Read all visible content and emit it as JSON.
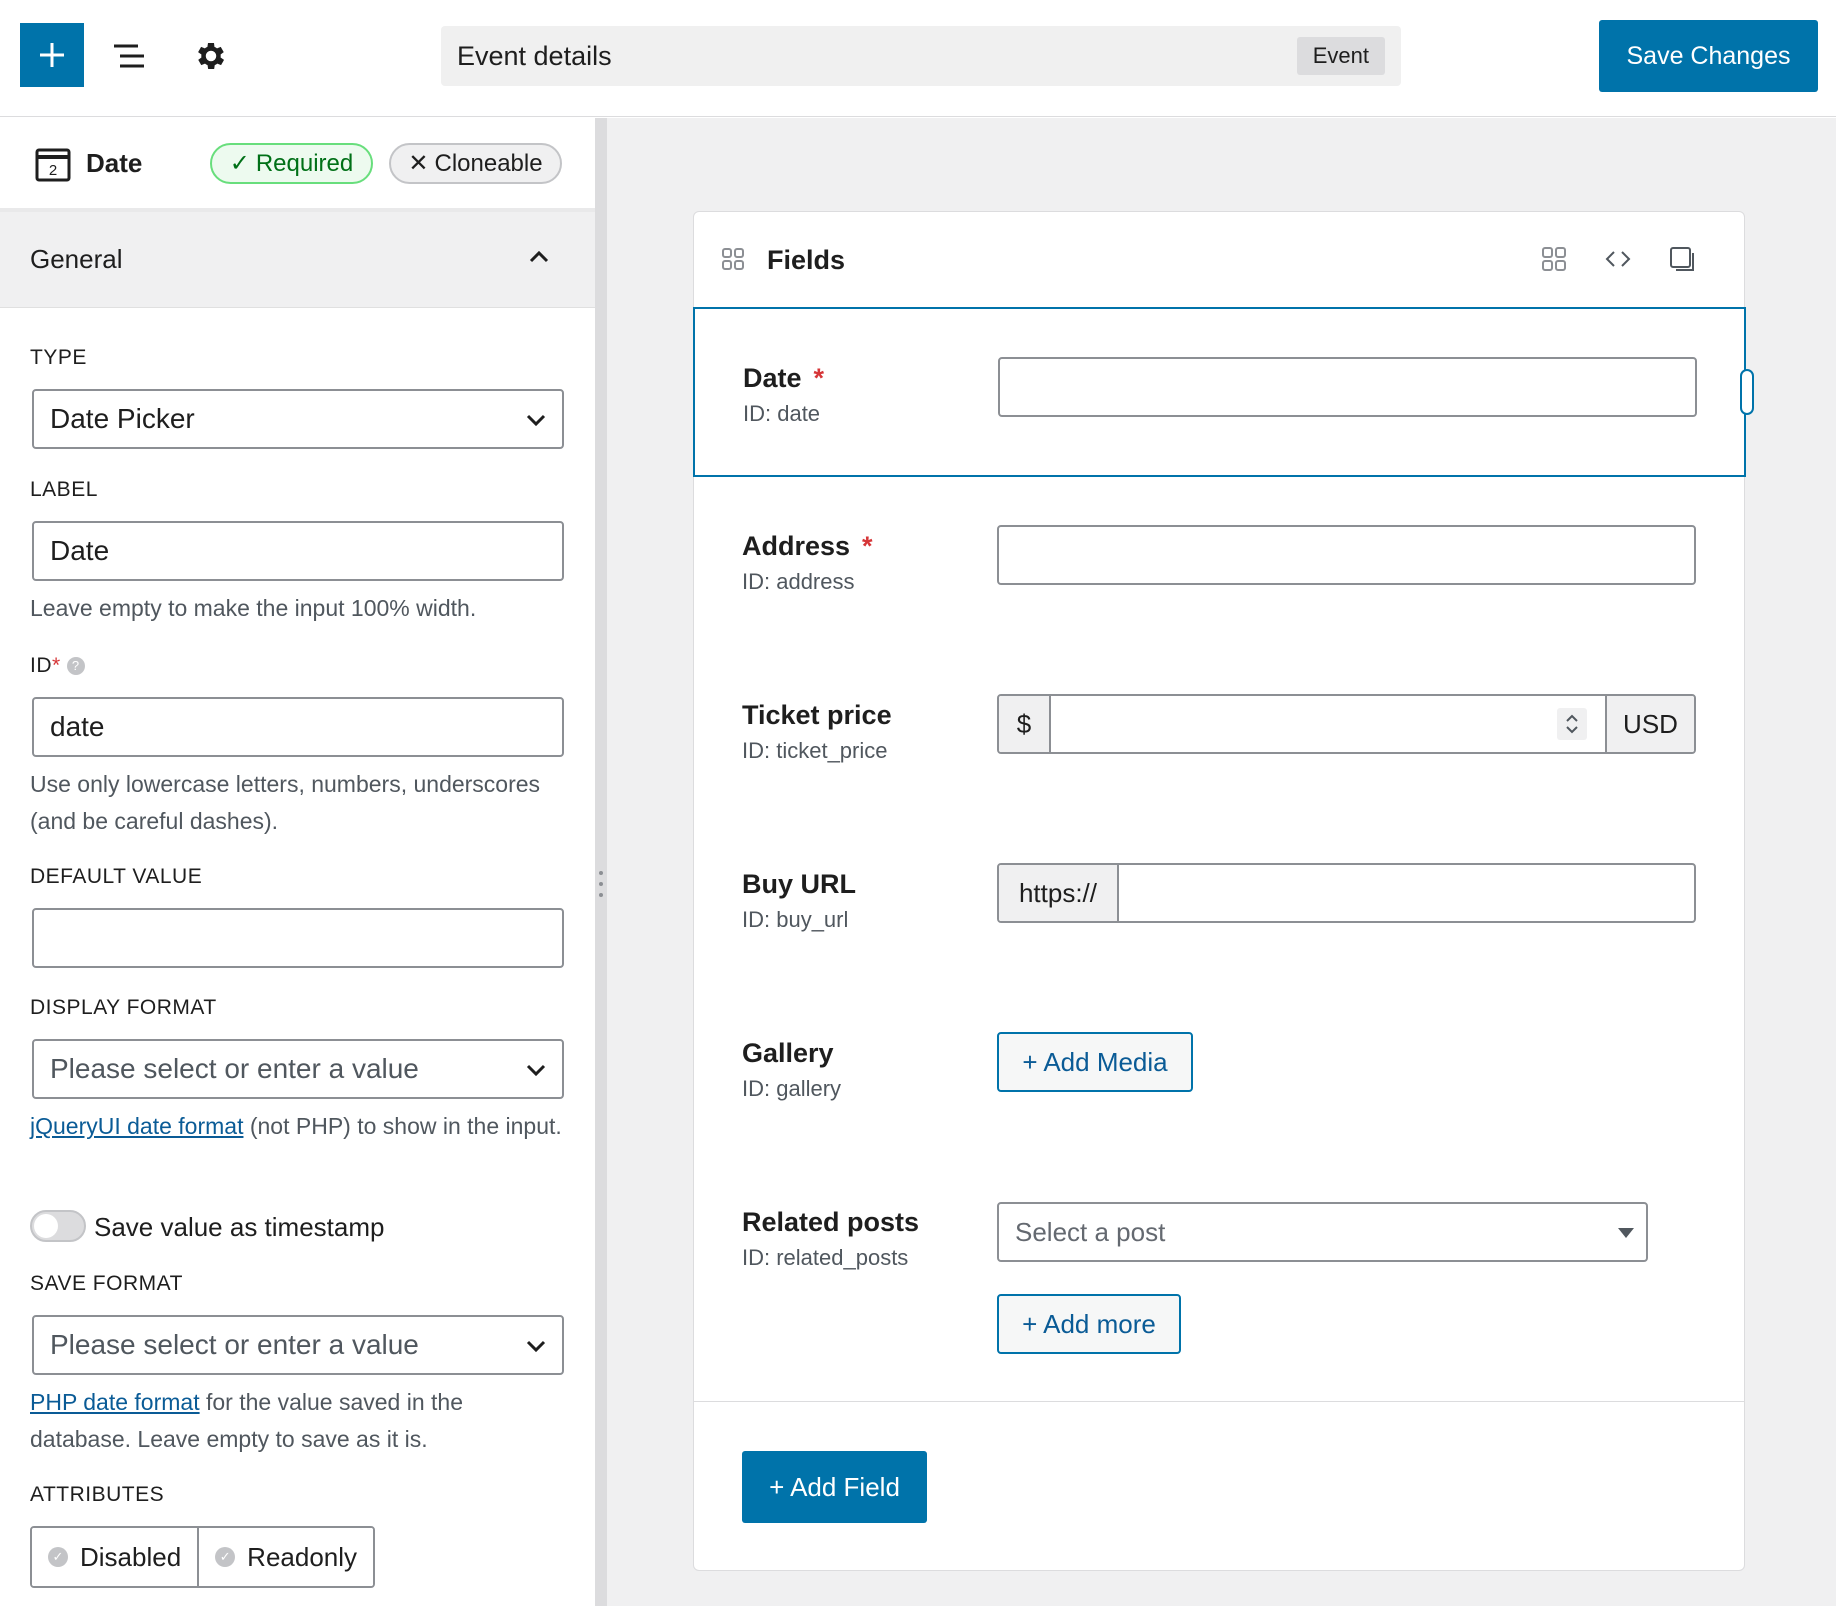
{
  "topbar": {
    "title": "Event details",
    "badge": "Event",
    "save_label": "Save Changes",
    "icons": [
      "plus-icon",
      "list-view-icon",
      "gear-icon"
    ]
  },
  "sidebar": {
    "field_name": "Date",
    "calendar_day": "2",
    "required_label": "Required",
    "cloneable_label": "Cloneable",
    "section_title": "General",
    "type_label": "TYPE",
    "type_value": "Date Picker",
    "label_label": "LABEL",
    "label_value": "Date",
    "label_help": "Leave empty to make the input 100% width.",
    "id_label": "ID",
    "id_value": "date",
    "id_help": "Use only lowercase letters, numbers, underscores (and be careful dashes).",
    "default_label": "DEFAULT VALUE",
    "default_value": "",
    "display_format_label": "DISPLAY FORMAT",
    "display_format_placeholder": "Please select or enter a value",
    "display_help_link": "jQueryUI date format",
    "display_help_text": " (not PHP) to show in the input.",
    "timestamp_label": "Save value as timestamp",
    "save_format_label": "SAVE FORMAT",
    "save_format_placeholder": "Please select or enter a value",
    "save_help_link": "PHP date format",
    "save_help_text": " for the value saved in the database. Leave empty to save as it is.",
    "attributes_label": "ATTRIBUTES",
    "attr_disabled": "Disabled",
    "attr_readonly": "Readonly"
  },
  "panel": {
    "title": "Fields",
    "fields": [
      {
        "name": "Date",
        "id": "ID: date",
        "required": "*"
      },
      {
        "name": "Address",
        "id": "ID: address",
        "required": "*"
      },
      {
        "name": "Ticket price",
        "id": "ID: ticket_price"
      },
      {
        "name": "Buy URL",
        "id": "ID: buy_url"
      },
      {
        "name": "Gallery",
        "id": "ID: gallery"
      },
      {
        "name": "Related posts",
        "id": "ID: related_posts"
      }
    ],
    "price_prefix": "$",
    "price_suffix": "USD",
    "url_prefix": "https://",
    "add_media": "+ Add Media",
    "post_placeholder": "Select a post",
    "add_more": "+ Add more",
    "add_field": "+ Add Field"
  },
  "colors": {
    "primary": "#0073aa",
    "required": "#d63638",
    "success_border": "#68de7c"
  }
}
